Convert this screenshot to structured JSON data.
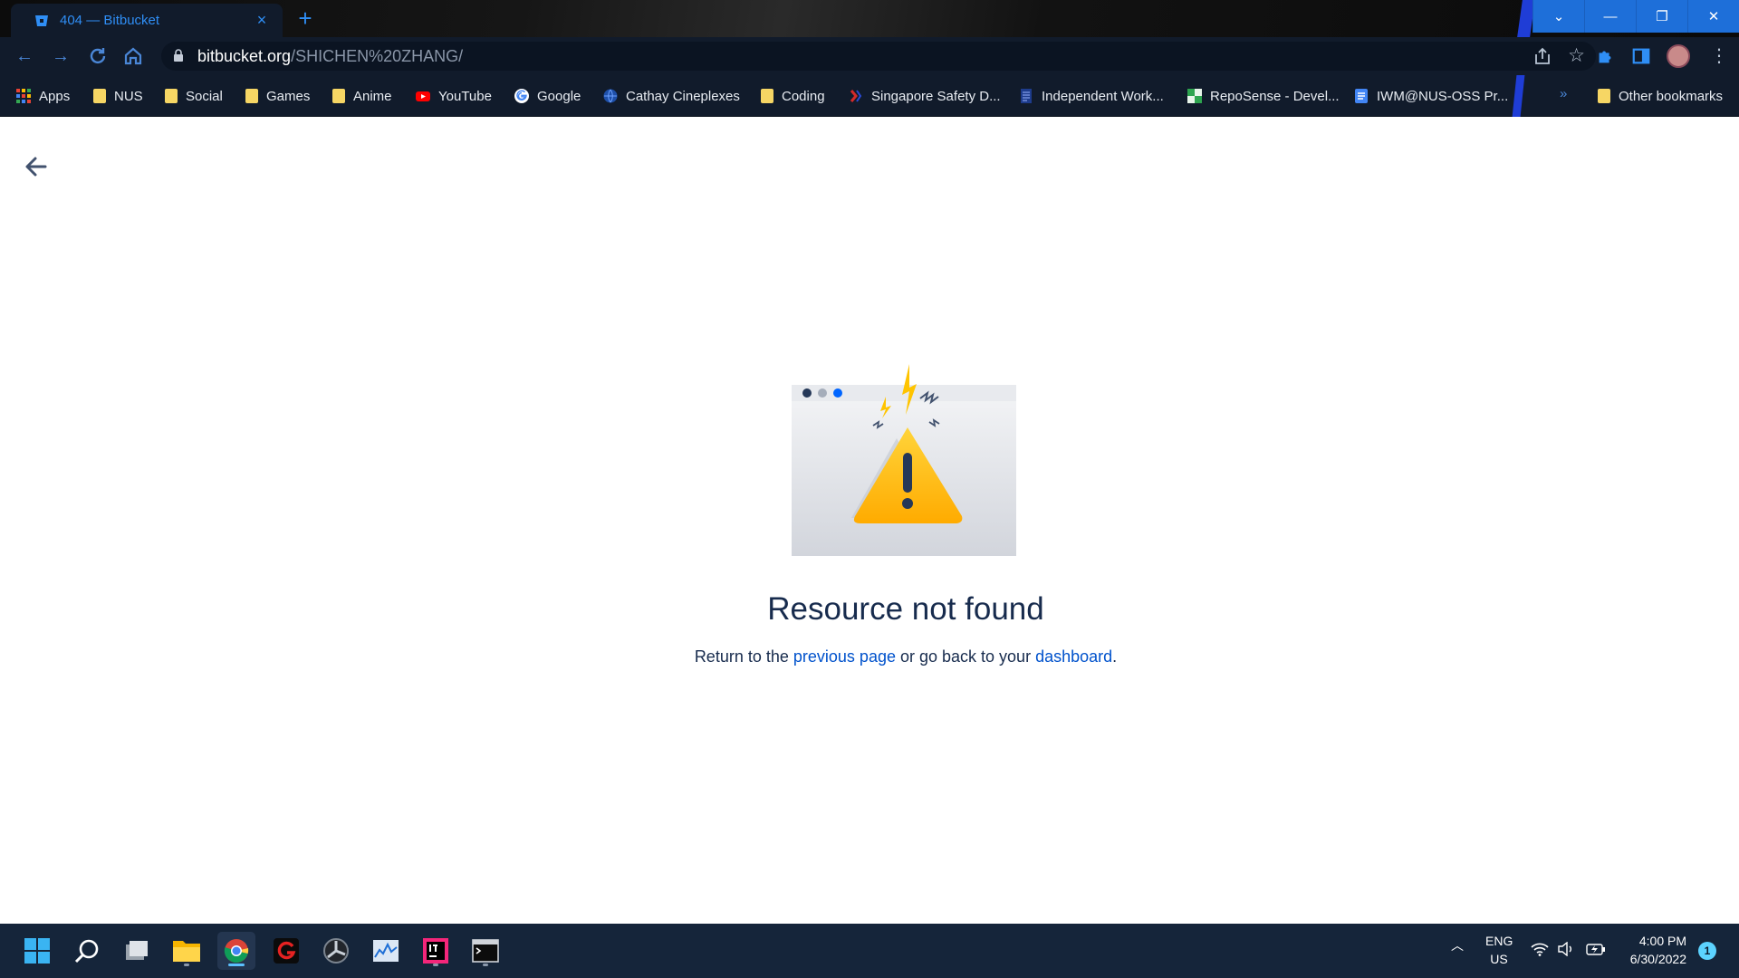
{
  "browser": {
    "tab": {
      "title": "404 — Bitbucket",
      "close": "×"
    },
    "new_tab": "+",
    "window": {
      "dropdown": "⌄",
      "minimize": "—",
      "restore": "❐",
      "close": "✕"
    },
    "address": {
      "host": "bitbucket.org",
      "path": "/SHICHEN%20ZHANG/"
    },
    "bookmarks": [
      {
        "label": "Apps",
        "icon": "apps-grid-icon"
      },
      {
        "label": "NUS",
        "icon": "folder-icon"
      },
      {
        "label": "Social",
        "icon": "folder-icon"
      },
      {
        "label": "Games",
        "icon": "folder-icon"
      },
      {
        "label": "Anime",
        "icon": "folder-icon"
      },
      {
        "label": "YouTube",
        "icon": "youtube-icon"
      },
      {
        "label": "Google",
        "icon": "google-icon"
      },
      {
        "label": "Cathay Cineplexes",
        "icon": "globe-icon"
      },
      {
        "label": "Coding",
        "icon": "folder-icon"
      },
      {
        "label": "Singapore Safety D...",
        "icon": "site-icon"
      },
      {
        "label": "Independent Work...",
        "icon": "doc-icon"
      },
      {
        "label": "RepoSense - Devel...",
        "icon": "reposense-icon"
      },
      {
        "label": "IWM@NUS-OSS Pr...",
        "icon": "docs-icon"
      }
    ],
    "bookmarks_more": "»",
    "other_bookmarks": "Other bookmarks"
  },
  "page": {
    "heading": "Resource not found",
    "message_prefix": "Return to the ",
    "link_previous": "previous page",
    "message_middle": " or go back to your ",
    "link_dashboard": "dashboard",
    "message_suffix": "."
  },
  "taskbar": {
    "lang_top": "ENG",
    "lang_bottom": "US",
    "time": "4:00 PM",
    "date": "6/30/2022",
    "notifications": "1"
  },
  "colors": {
    "accent": "#0052cc",
    "heading": "#172b4d",
    "warning": "#ffc400",
    "chrome_accent": "#2f8ef5"
  }
}
